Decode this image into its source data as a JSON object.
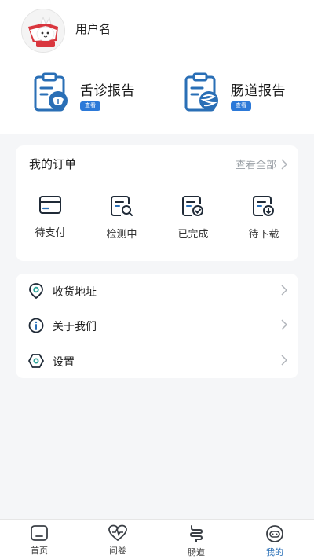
{
  "profile": {
    "username": "用户名"
  },
  "reports": [
    {
      "title": "舌诊报告",
      "button": "查看",
      "icon": "clipboard-tongue-icon"
    },
    {
      "title": "肠道报告",
      "button": "查看",
      "icon": "clipboard-intestine-icon"
    }
  ],
  "orders": {
    "title": "我的订单",
    "view_all": "查看全部",
    "items": [
      {
        "label": "待支付",
        "icon": "card-icon"
      },
      {
        "label": "检测中",
        "icon": "document-search-icon"
      },
      {
        "label": "已完成",
        "icon": "document-check-icon"
      },
      {
        "label": "待下载",
        "icon": "document-download-icon"
      }
    ]
  },
  "menu": [
    {
      "label": "收货地址",
      "icon": "location-pin-icon"
    },
    {
      "label": "关于我们",
      "icon": "info-icon"
    },
    {
      "label": "设置",
      "icon": "hex-settings-icon"
    }
  ],
  "tabbar": [
    {
      "label": "首页",
      "icon": "home-icon",
      "active": false
    },
    {
      "label": "问卷",
      "icon": "heart-pulse-icon",
      "active": false
    },
    {
      "label": "肠道",
      "icon": "intestine-icon",
      "active": false
    },
    {
      "label": "我的",
      "icon": "profile-face-icon",
      "active": true
    }
  ],
  "colors": {
    "accent": "#2c79d8",
    "icon_blue": "#2a6fb6",
    "background": "#f5f6f8"
  }
}
